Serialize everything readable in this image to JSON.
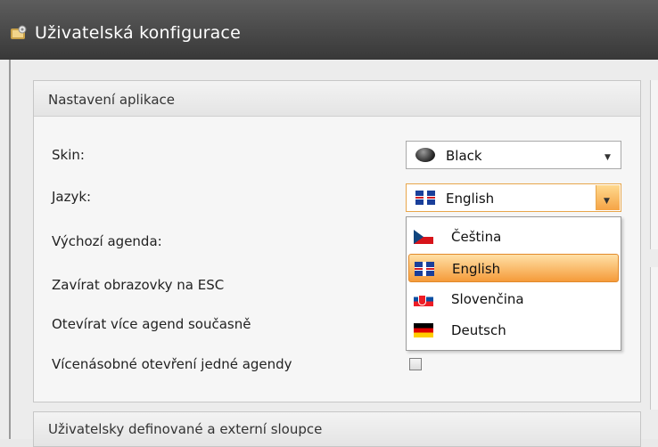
{
  "window": {
    "title": "Uživatelská konfigurace",
    "icon": "app-icon"
  },
  "app_settings": {
    "title": "Nastavení aplikace",
    "skin": {
      "label": "Skin:",
      "value": "Black",
      "icon": "black-ball-icon"
    },
    "language": {
      "label": "Jazyk:",
      "value": "English",
      "icon": "uk-flag-icon",
      "options": [
        {
          "label": "Čeština",
          "icon": "cz-flag-icon"
        },
        {
          "label": "English",
          "icon": "uk-flag-icon",
          "selected": true
        },
        {
          "label": "Slovenčina",
          "icon": "sk-flag-icon"
        },
        {
          "label": "Deutsch",
          "icon": "de-flag-icon"
        }
      ]
    },
    "default_agenda": {
      "label": "Výchozí agenda:"
    },
    "close_on_esc": {
      "label": "Zavírat obrazovky na ESC"
    },
    "open_multiple": {
      "label": "Otevírat více agend současně"
    },
    "multi_open_same": {
      "label": "Vícenásobné otevření jedné agendy",
      "checked": false
    }
  },
  "user_columns": {
    "title": "Uživatelsky definované a externí sloupce"
  },
  "colors": {
    "titlebar": "#3f3f3f",
    "accent": "#f5a445",
    "selection": "#f59b3a"
  }
}
